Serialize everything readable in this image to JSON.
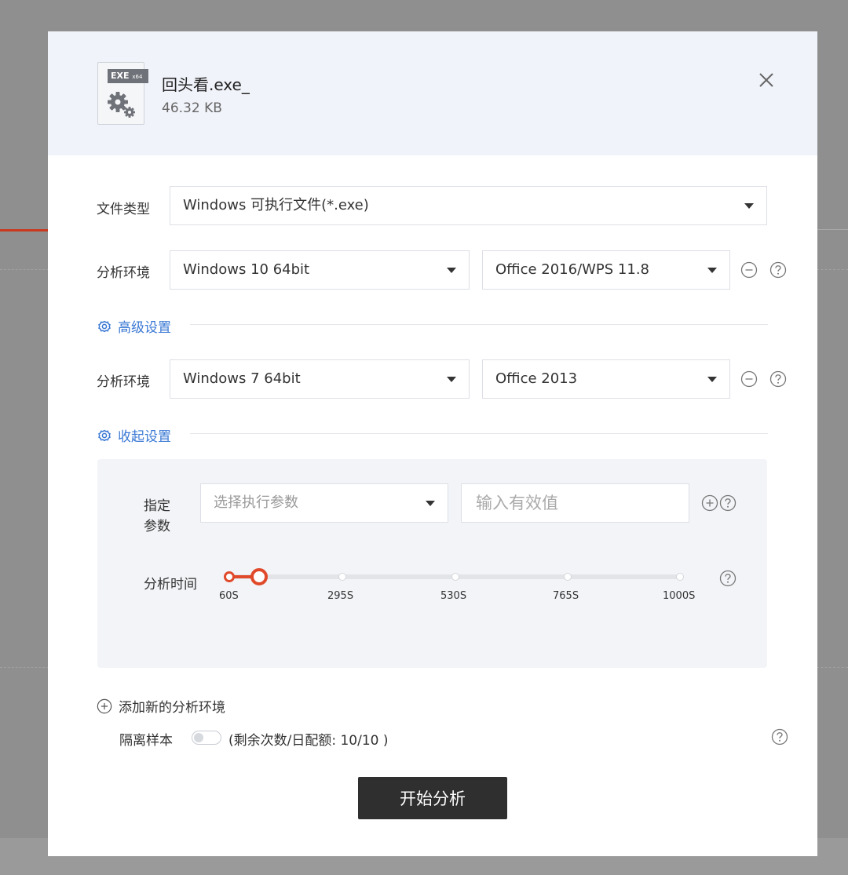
{
  "file": {
    "badge_main": "EXE",
    "badge_sub": "x64",
    "name": "回头看.exe_",
    "size": "46.32 KB"
  },
  "file_type": {
    "label": "文件类型",
    "value": "Windows 可执行文件(*.exe)"
  },
  "environments": [
    {
      "label": "分析环境",
      "os": "Windows 10 64bit",
      "office": "Office 2016/WPS 11.8"
    },
    {
      "label": "分析环境",
      "os": "Windows 7 64bit",
      "office": "Office 2013"
    }
  ],
  "advanced_settings_link": "高级设置",
  "collapse_settings_link": "收起设置",
  "advanced": {
    "param_label_1": "指定",
    "param_label_2": "参数",
    "param_select_placeholder": "选择执行参数",
    "param_input_placeholder": "输入有效值",
    "time_label": "分析时间",
    "time_ticks": [
      "60S",
      "295S",
      "530S",
      "765S",
      "1000S"
    ],
    "time_selected": "60S"
  },
  "add_environment": "添加新的分析环境",
  "quarantine": {
    "label": "隔离样本",
    "enabled": false,
    "quota_text": "(剩余次数/日配额: 10/10 )"
  },
  "start_button": "开始分析",
  "colors": {
    "accent": "#e04a2a",
    "link": "#3a78d4",
    "primary_button": "#2f2f2f"
  }
}
